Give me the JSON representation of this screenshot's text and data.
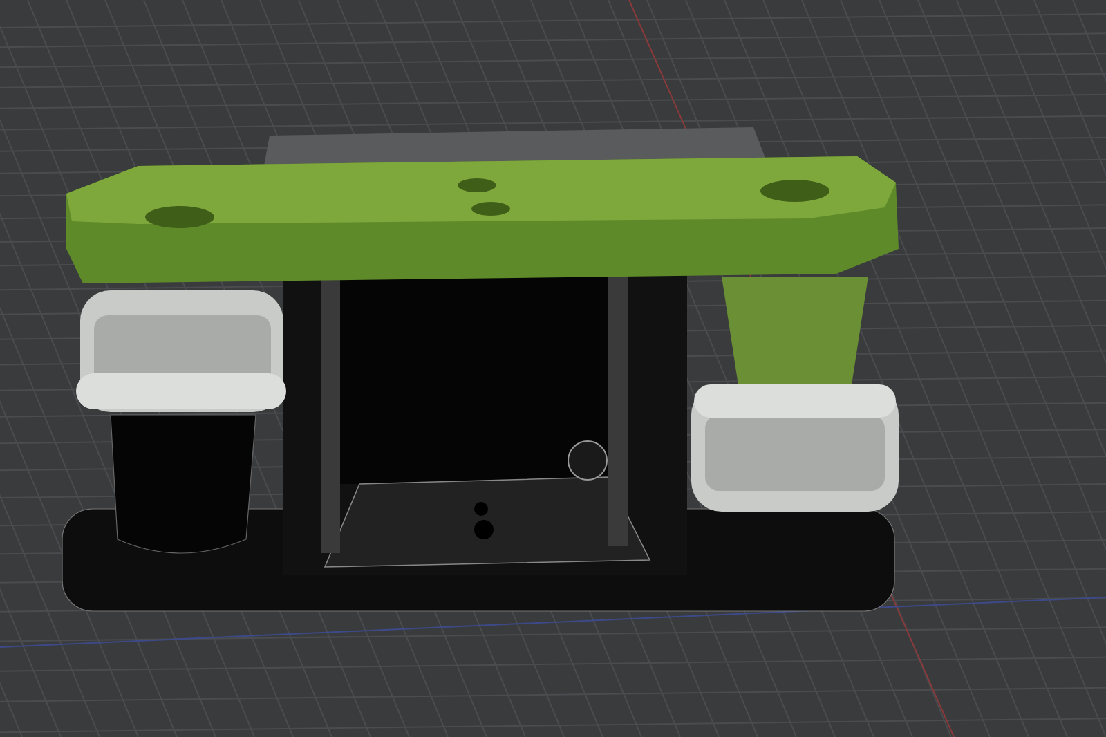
{
  "viewport": {
    "kind": "cad-3d"
  }
}
